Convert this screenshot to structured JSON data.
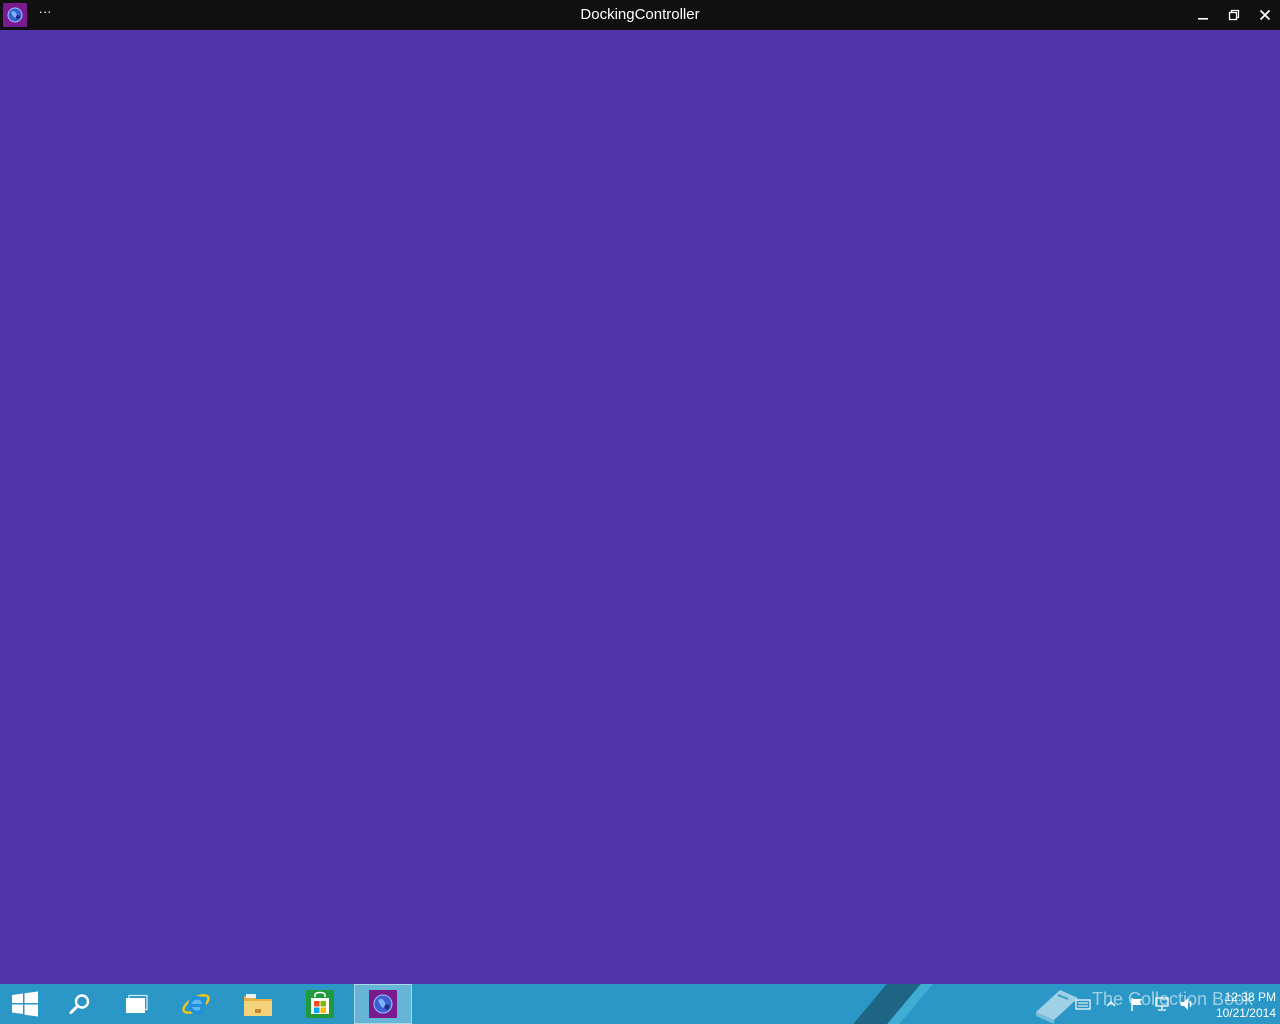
{
  "window": {
    "title": "DockingController",
    "more_label": "···"
  },
  "taskbar": {
    "watermark": "The Collection Book",
    "clock": {
      "time": "12:38 PM",
      "date": "10/21/2014"
    }
  },
  "colors": {
    "titlebar": "#101010",
    "content_background": "#5034ab",
    "taskbar": "#2b97c6",
    "app_icon": "#7a1a8e",
    "store_green": "#1e9a3b"
  },
  "icons": {
    "app": "globe-app-icon",
    "start": "windows-logo-icon",
    "search": "search-icon",
    "task_view": "task-view-icon",
    "browser": "internet-explorer-icon",
    "files": "file-explorer-icon",
    "store": "store-icon",
    "tray": [
      "keyboard-icon",
      "chevron-up-icon",
      "flag-icon",
      "network-icon",
      "volume-icon"
    ]
  }
}
